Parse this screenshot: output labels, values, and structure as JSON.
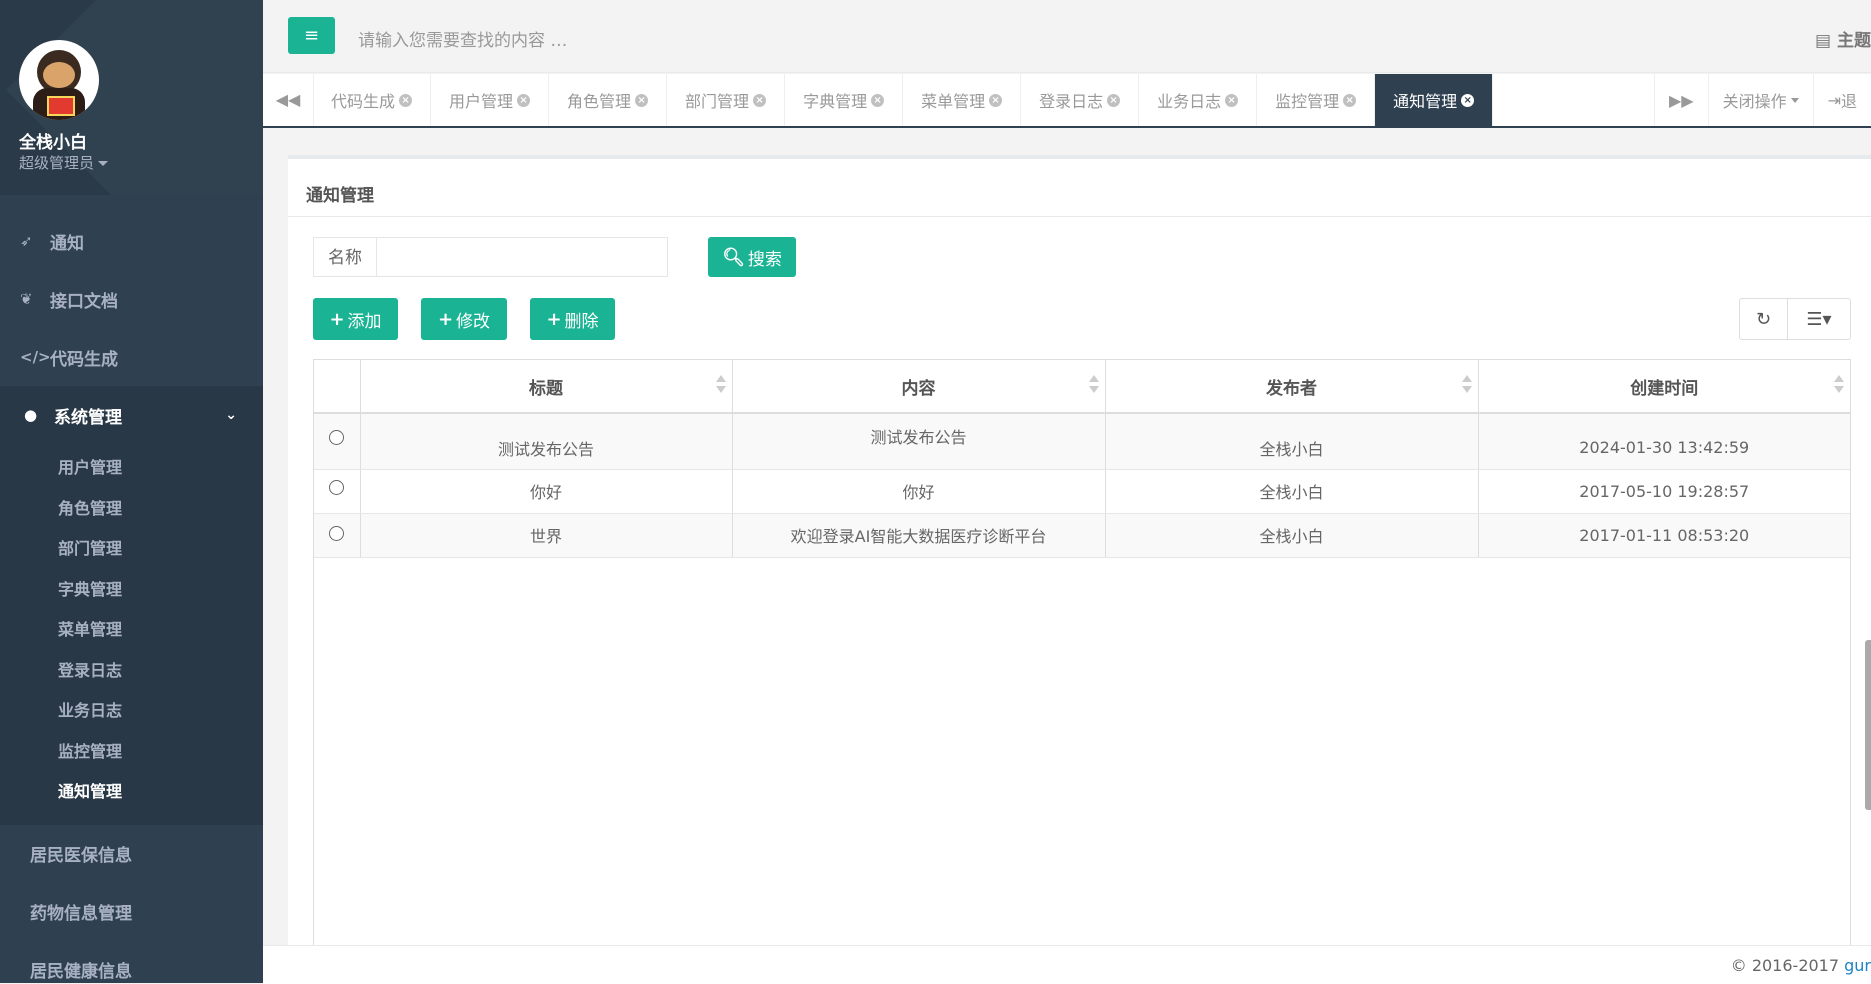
{
  "user": {
    "name": "全栈小白",
    "role": "超级管理员"
  },
  "sidebar": {
    "items": [
      {
        "icon": "rocket-icon",
        "label": "通知"
      },
      {
        "icon": "leaf-icon",
        "label": "接口文档"
      },
      {
        "icon": "code-icon",
        "label": "代码生成"
      },
      {
        "icon": "user-icon",
        "label": "系统管理"
      }
    ],
    "system_sub": [
      "用户管理",
      "角色管理",
      "部门管理",
      "字典管理",
      "菜单管理",
      "登录日志",
      "业务日志",
      "监控管理",
      "通知管理"
    ],
    "bottom": [
      "居民医保信息",
      "药物信息管理",
      "居民健康信息"
    ]
  },
  "header": {
    "search_placeholder": "请输入您需要查找的内容 …",
    "theme_label": "主题"
  },
  "tabs": [
    "代码生成",
    "用户管理",
    "角色管理",
    "部门管理",
    "字典管理",
    "菜单管理",
    "登录日志",
    "业务日志",
    "监控管理",
    "通知管理"
  ],
  "tab_actions": {
    "close_ops": "关闭操作",
    "exit": "退"
  },
  "panel": {
    "title": "通知管理",
    "filter_label": "名称",
    "search_btn": "搜索",
    "add_btn": "添加",
    "edit_btn": "修改",
    "delete_btn": "删除"
  },
  "table": {
    "columns": [
      "标题",
      "内容",
      "发布者",
      "创建时间"
    ],
    "rows": [
      [
        "测试发布公告",
        "测试发布公告",
        "全栈小白",
        "2024-01-30 13:42:59"
      ],
      [
        "你好",
        "你好",
        "全栈小白",
        "2017-05-10 19:28:57"
      ],
      [
        "世界",
        "欢迎登录AI智能大数据医疗诊断平台",
        "全栈小白",
        "2017-01-11 08:53:20"
      ]
    ]
  },
  "footer": {
    "copyright": "© 2016-2017 ",
    "link": "gur"
  },
  "colors": {
    "sidebar": "#2f4050",
    "accent": "#1ab394"
  }
}
